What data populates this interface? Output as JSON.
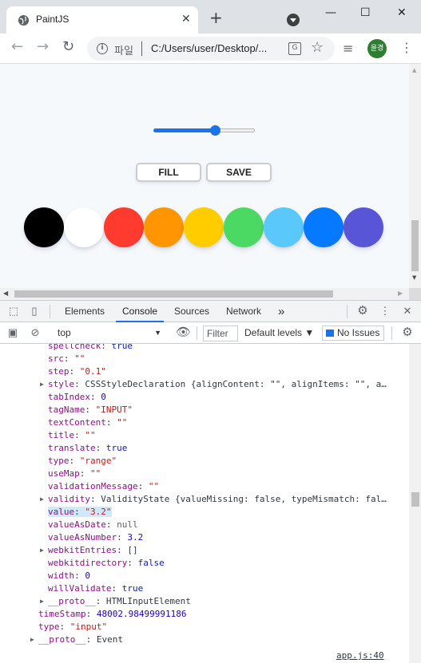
{
  "browser": {
    "tab_title": "PaintJS",
    "tab_close": "✕",
    "new_tab": "+",
    "minimize": "—",
    "maximize": "☐",
    "close": "✕",
    "scheme_label": "파일",
    "url": "C:/Users/user/Desktop/...",
    "profile_initials": "윤경",
    "profile_color": "#2e7d32"
  },
  "page": {
    "slider_value": 3.2,
    "fill_label": "FILL",
    "save_label": "SAVE",
    "colors": [
      "#000000",
      "#ffffff",
      "#ff3b30",
      "#ff9500",
      "#ffcc00",
      "#4cd963",
      "#5ac8fa",
      "#0579ff",
      "#5856d6"
    ]
  },
  "devtools": {
    "tabs": [
      "Elements",
      "Console",
      "Sources",
      "Network"
    ],
    "active_tab": "Console",
    "more_tabs": "»",
    "context": "top",
    "filter_placeholder": "Filter",
    "levels": "Default levels ▼",
    "issues": "No Issues",
    "source_link": "app.js:40"
  },
  "console_lines": [
    {
      "key": "spellcheck",
      "sep": ": ",
      "val": "true"
    },
    {
      "key": "src",
      "sep": ": ",
      "val": "\"\""
    },
    {
      "key": "step",
      "sep": ": ",
      "val": "\"0.1\""
    },
    {
      "key": "style",
      "sep": ": ",
      "val": "CSSStyleDeclaration {alignContent: \"\", alignItems: \"\", a…"
    },
    {
      "key": "tabIndex",
      "sep": ": ",
      "val": "0"
    },
    {
      "key": "tagName",
      "sep": ": ",
      "val": "\"INPUT\""
    },
    {
      "key": "textContent",
      "sep": ": ",
      "val": "\"\""
    },
    {
      "key": "title",
      "sep": ": ",
      "val": "\"\""
    },
    {
      "key": "translate",
      "sep": ": ",
      "val": "true"
    },
    {
      "key": "type",
      "sep": ": ",
      "val": "\"range\""
    },
    {
      "key": "useMap",
      "sep": ": ",
      "val": "\"\""
    },
    {
      "key": "validationMessage",
      "sep": ": ",
      "val": "\"\""
    },
    {
      "key": "validity",
      "sep": ": ",
      "val": "ValidityState {valueMissing: false, typeMismatch: fal…"
    },
    {
      "key": "value",
      "sep": ": ",
      "val": "\"3.2\""
    },
    {
      "key": "valueAsDate",
      "sep": ": ",
      "val": "null"
    },
    {
      "key": "valueAsNumber",
      "sep": ": ",
      "val": "3.2"
    },
    {
      "key": "webkitEntries",
      "sep": ": ",
      "val": "[]"
    },
    {
      "key": "webkitdirectory",
      "sep": ": ",
      "val": "false"
    },
    {
      "key": "width",
      "sep": ": ",
      "val": "0"
    },
    {
      "key": "willValidate",
      "sep": ": ",
      "val": "true"
    },
    {
      "key": "__proto__",
      "sep": ": ",
      "val": "HTMLInputElement"
    },
    {
      "key": "timeStamp",
      "sep": ": ",
      "val": "48002.98499991186"
    },
    {
      "key": "type",
      "sep": ": ",
      "val": "\"input\""
    },
    {
      "key": "__proto__",
      "sep": ": ",
      "val": "Event"
    }
  ]
}
